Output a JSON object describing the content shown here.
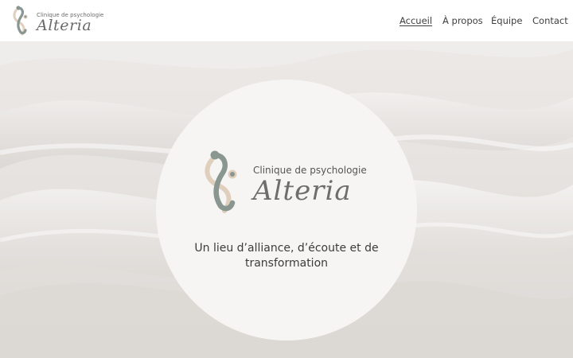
{
  "brand": {
    "subtitle": "Clinique de psychologie",
    "name": "Alteria"
  },
  "nav": {
    "items": [
      {
        "label": "Accueil",
        "active": true
      },
      {
        "label": "À propos",
        "active": false
      },
      {
        "label": "Équipe",
        "active": false
      },
      {
        "label": "Contact",
        "active": false
      }
    ]
  },
  "hero": {
    "logo_subtitle": "Clinique de psychologie",
    "logo_name": "Alteria",
    "tagline_line1": "Un lieu d’alliance, d’écoute et de",
    "tagline_line2": "transformation"
  },
  "colors": {
    "logo_gray": "#8a9690",
    "logo_beige": "#e0cfbd",
    "text": "#3c3c3c",
    "circle": "#f6f5f3"
  }
}
